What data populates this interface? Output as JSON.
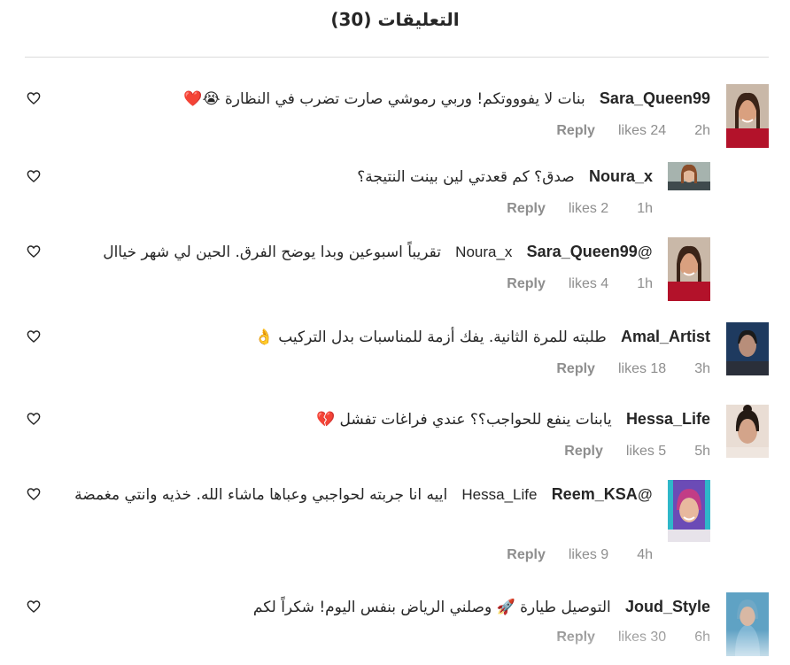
{
  "header": {
    "title": "التعليقات (30)"
  },
  "comments": [
    {
      "username": "Sara_Queen99",
      "mention": "",
      "text": "بنات لا يفوووتكم! وربي رموشي صارت تضرب في النظارة 😭❤️",
      "reply_label": "Reply",
      "likes": "likes 24",
      "time": "2h"
    },
    {
      "username": "Noura_x",
      "mention": "",
      "text": "صدق؟ كم قعدتي لين بينت النتيجة؟",
      "reply_label": "Reply",
      "likes": "likes 2",
      "time": "1h"
    },
    {
      "username": "Sara_Queen99",
      "mention": "@Noura_x",
      "text": "تقريباً اسبوعين وبدا يوضح الفرق. الحين لي شهر خياال",
      "reply_label": "Reply",
      "likes": "likes 4",
      "time": "1h"
    },
    {
      "username": "Amal_Artist",
      "mention": "",
      "text": "طلبته للمرة الثانية. يفك أزمة للمناسبات بدل التركيب 👌",
      "reply_label": "Reply",
      "likes": "likes 18",
      "time": "3h"
    },
    {
      "username": "Hessa_Life",
      "mention": "",
      "text": "يابنات ينفع للحواجب؟؟ عندي فراغات تفشل 💔",
      "reply_label": "Reply",
      "likes": "likes 5",
      "time": "5h"
    },
    {
      "username": "Reem_KSA",
      "mention": "@Hessa_Life",
      "text": "اييه انا جربته لحواجبي وعباها ماشاء الله. خذيه وانتي مغمضة",
      "reply_label": "Reply",
      "likes": "likes 9",
      "time": "4h"
    },
    {
      "username": "Joud_Style",
      "mention": "",
      "text": "التوصيل طيارة 🚀 وصلني الرياض بنفس اليوم! شكراً لكم",
      "reply_label": "Reply",
      "likes": "likes 30",
      "time": "6h"
    }
  ],
  "icons": {
    "like": "heart-outline-icon",
    "avatar": "avatar-photo"
  },
  "colors": {
    "text": "#262626",
    "muted": "#8e8e8e",
    "divider": "#dbdbdb"
  }
}
